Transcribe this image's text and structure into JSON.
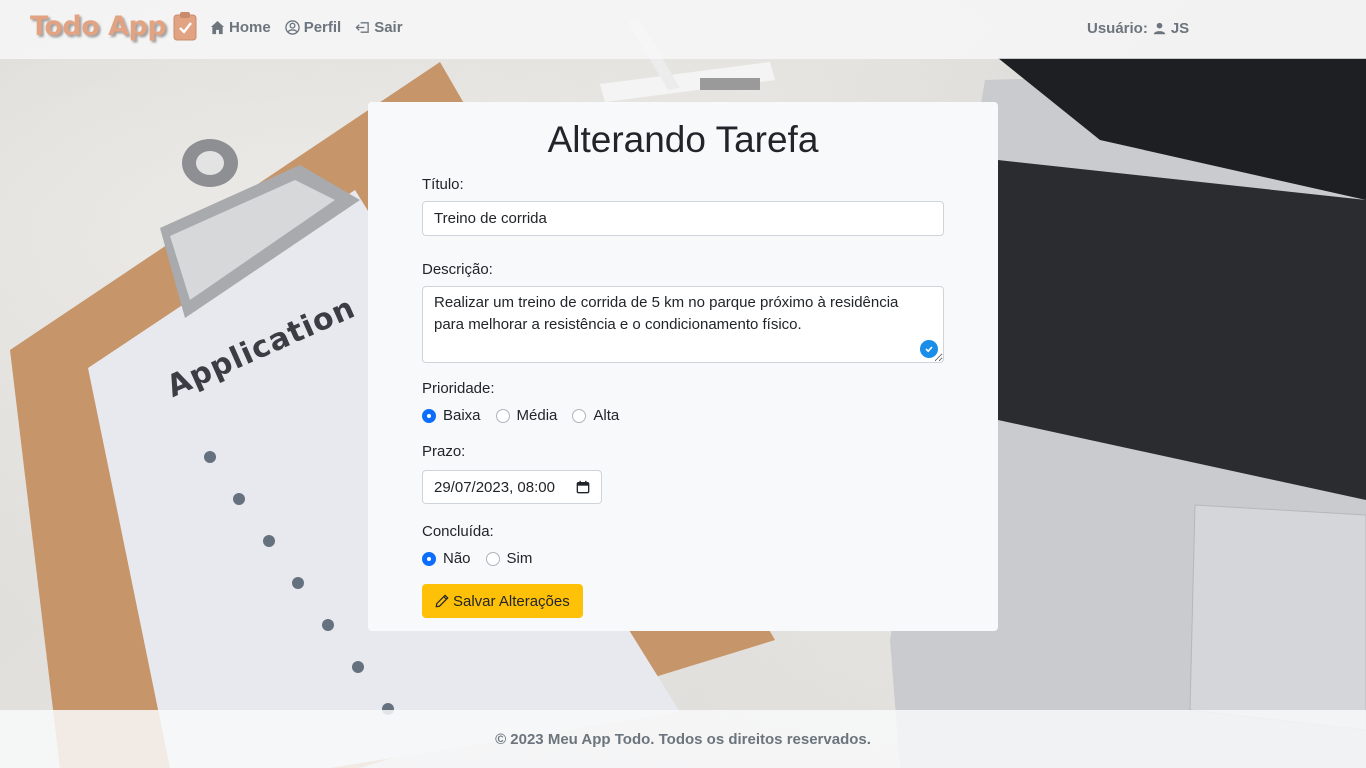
{
  "navbar": {
    "brand": "Todo App",
    "brand_icon": "clipboard-check-icon",
    "links": [
      {
        "label": "Home",
        "icon": "house-icon"
      },
      {
        "label": "Perfil",
        "icon": "person-circle-icon"
      },
      {
        "label": "Sair",
        "icon": "box-arrow-left-icon"
      }
    ],
    "user_label": "Usuário:",
    "user_icon": "person-icon",
    "user_name": "JS"
  },
  "background": {
    "clipboard_text": "Application"
  },
  "form": {
    "heading": "Alterando Tarefa",
    "title_label": "Título:",
    "title_value": "Treino de corrida",
    "description_label": "Descrição:",
    "description_value": "Realizar um treino de corrida de 5 km no parque próximo à residência para melhorar a resistência e o condicionamento físico.",
    "priority_label": "Prioridade:",
    "priority_options": [
      "Baixa",
      "Média",
      "Alta"
    ],
    "priority_selected": "Baixa",
    "deadline_label": "Prazo:",
    "deadline_value": "29/07/2023, 08:00",
    "done_label": "Concluída:",
    "done_options": [
      "Não",
      "Sim"
    ],
    "done_selected": "Não",
    "save_button": "Salvar Alterações"
  },
  "footer": {
    "text": "© 2023 Meu App Todo. Todos os direitos reservados."
  },
  "colors": {
    "brand": "#e2a383",
    "accent": "#0d6efd",
    "warning": "#ffc107",
    "muted": "#6c757d"
  }
}
